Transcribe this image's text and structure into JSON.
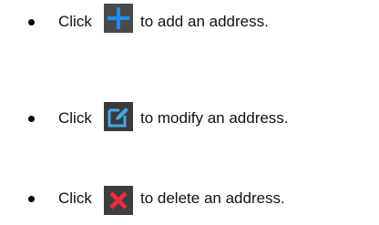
{
  "instructions": [
    {
      "prefix": "Click",
      "icon": "plus-icon",
      "suffix": "to add an address.",
      "icon_color": "#1f8cf0",
      "icon_background": "#4a4a4a"
    },
    {
      "prefix": "Click",
      "icon": "edit-icon",
      "suffix": "to modify an address.",
      "icon_color": "#47a6e6",
      "icon_background": "#3a3a3a"
    },
    {
      "prefix": "Click",
      "icon": "close-icon",
      "suffix": "to delete an address.",
      "icon_color": "#ef2a3c",
      "icon_background": "#3e3e3e"
    }
  ]
}
